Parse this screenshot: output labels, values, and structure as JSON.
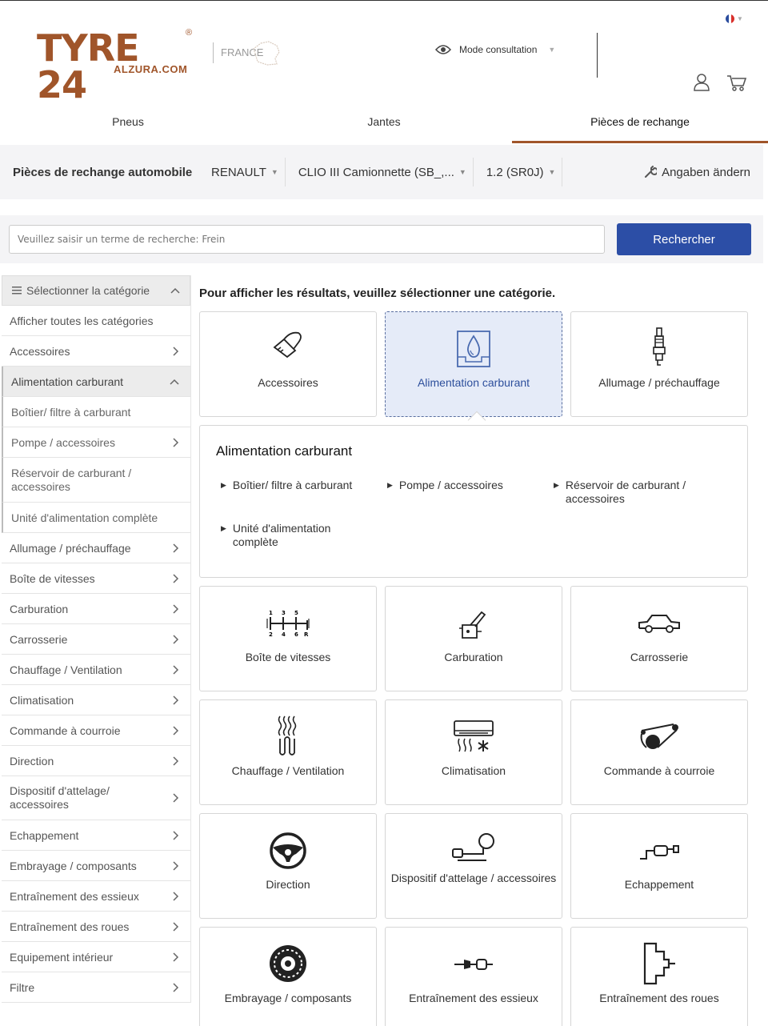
{
  "header": {
    "logo_main": "TYRE 24",
    "logo_reg": "®",
    "logo_sub": "ALZURA.COM",
    "country": "FRANCE",
    "mode_label": "Mode consultation",
    "icons": [
      "eye-icon",
      "user-icon",
      "cart-icon",
      "france-flag-icon"
    ]
  },
  "tabs": [
    "Pneus",
    "Jantes",
    "Pièces de rechange"
  ],
  "vehicle_bar": {
    "title": "Pièces de rechange automobile",
    "brand": "RENAULT",
    "model": "CLIO III Camionnette (SB_,...",
    "engine": "1.2 (SR0J)",
    "change_label": "Angaben ändern"
  },
  "search": {
    "placeholder": "Veuillez saisir un terme de recherche: Frein",
    "button": "Rechercher"
  },
  "sidebar": {
    "header": "Sélectionner la catégorie",
    "show_all": "Afficher toutes les catégories",
    "items": [
      "Accessoires",
      "Alimentation carburant",
      "Boîtier/ filtre à carburant",
      "Pompe / accessoires",
      "Réservoir de carburant / accessoires",
      "Unité d'alimentation complète",
      "Allumage / préchauffage",
      "Boîte de vitesses",
      "Carburation",
      "Carrosserie",
      "Chauffage / Ventilation",
      "Climatisation",
      "Commande à courroie",
      "Direction",
      "Dispositif d'attelage/ accessoires",
      "Echappement",
      "Embrayage / composants",
      "Entraînement des essieux",
      "Entraînement des roues",
      "Equipement intérieur",
      "Filtre"
    ]
  },
  "content": {
    "instruction": "Pour afficher les résultats, veuillez sélectionner une catégorie.",
    "tiles": [
      "Accessoires",
      "Alimentation carburant",
      "Allumage / préchauffage",
      "Boîte de vitesses",
      "Carburation",
      "Carrosserie",
      "Chauffage / Ventilation",
      "Climatisation",
      "Commande à courroie",
      "Direction",
      "Dispositif d'attelage / accessoires",
      "Echappement",
      "Embrayage / composants",
      "Entraînement des essieux",
      "Entraînement des roues"
    ],
    "gearbox_numbers": [
      "1",
      "3",
      "5",
      "2",
      "4",
      "6",
      "R"
    ]
  },
  "panel": {
    "title": "Alimentation carburant",
    "links": [
      "Boîtier/ filtre à carburant",
      "Pompe / accessoires",
      "Réservoir de carburant / accessoires",
      "Unité d'alimentation complète"
    ]
  },
  "colors": {
    "brand": "#a0552a",
    "button": "#2c4ea6",
    "active_tile_bg": "#e5ebf8",
    "active_text": "#2d4f9c"
  }
}
